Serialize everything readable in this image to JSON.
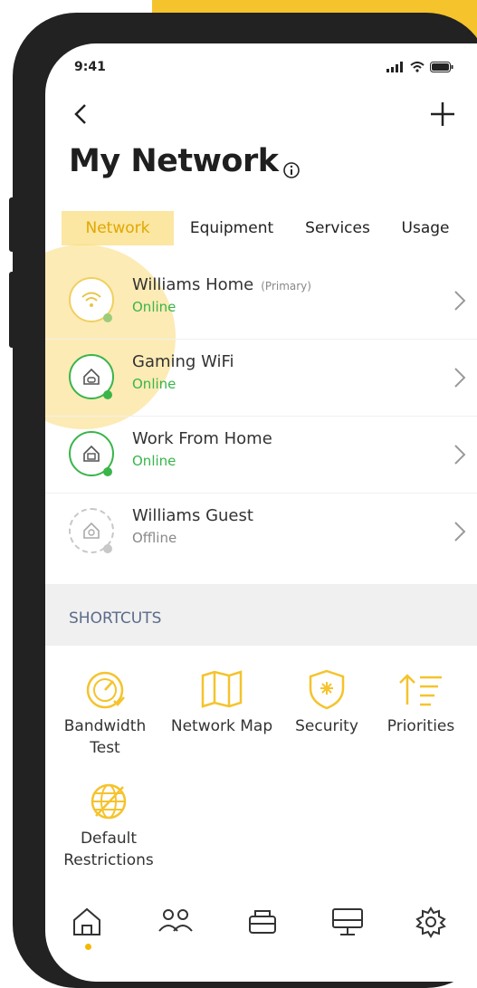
{
  "status_bar": {
    "time": "9:41"
  },
  "header": {
    "title": "My Network"
  },
  "tabs": [
    {
      "label": "Network",
      "active": true
    },
    {
      "label": "Equipment",
      "active": false
    },
    {
      "label": "Services",
      "active": false
    },
    {
      "label": "Usage",
      "active": false
    }
  ],
  "networks": [
    {
      "name": "Williams Home",
      "tag": "(Primary)",
      "status": "Online",
      "icon": "wifi-icon"
    },
    {
      "name": "Gaming WiFi",
      "tag": "",
      "status": "Online",
      "icon": "gaming-network-icon"
    },
    {
      "name": "Work From Home",
      "tag": "",
      "status": "Online",
      "icon": "work-network-icon"
    },
    {
      "name": "Williams Guest",
      "tag": "",
      "status": "Offline",
      "icon": "guest-network-icon"
    }
  ],
  "shortcuts": {
    "heading": "SHORTCUTS",
    "items": [
      {
        "label_line1": "Bandwidth",
        "label_line2": "Test",
        "icon": "speedometer-icon"
      },
      {
        "label_line1": "Network Map",
        "label_line2": "",
        "icon": "map-icon"
      },
      {
        "label_line1": "Security",
        "label_line2": "",
        "icon": "shield-icon"
      },
      {
        "label_line1": "Priorities",
        "label_line2": "",
        "icon": "priorities-icon"
      },
      {
        "label_line1": "Default",
        "label_line2": "Restrictions",
        "icon": "restrictions-globe-icon"
      }
    ]
  },
  "bottom_nav": [
    {
      "icon": "home-icon",
      "active": true
    },
    {
      "icon": "people-icon",
      "active": false
    },
    {
      "icon": "router-icon",
      "active": false
    },
    {
      "icon": "monitor-icon",
      "active": false
    },
    {
      "icon": "gear-icon",
      "active": false
    }
  ],
  "colors": {
    "accent": "#f5c32c",
    "online": "#39b54a",
    "offline": "#c8c8c8",
    "frame": "#222222"
  }
}
